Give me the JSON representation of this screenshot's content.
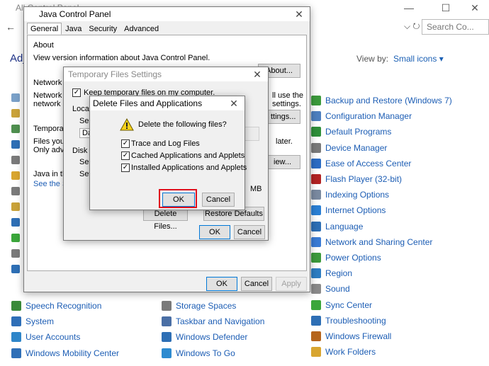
{
  "control_panel": {
    "title": "All Control Panel",
    "back_glyph": "←",
    "refresh_glyph": "⌵ ↻",
    "search_placeholder": "Search Co...",
    "heading": "Adj",
    "view_by_label": "View by:",
    "view_by_value": "Small icons ▾",
    "window_min": "—",
    "window_max": "☐",
    "window_close": "✕",
    "left_column": [
      {
        "label": "Speech Recognition",
        "icon": "speech-icon",
        "color": "#3a8a3a"
      },
      {
        "label": "System",
        "icon": "system-icon",
        "color": "#2f6fb7"
      },
      {
        "label": "User Accounts",
        "icon": "users-icon",
        "color": "#2f86c9"
      },
      {
        "label": "Windows Mobility Center",
        "icon": "mobility-icon",
        "color": "#2f6fb7"
      }
    ],
    "middle_column": [
      {
        "label": "Storage Spaces",
        "icon": "storage-icon",
        "color": "#7a7a7a"
      },
      {
        "label": "Taskbar and Navigation",
        "icon": "taskbar-icon",
        "color": "#4a6fa5"
      },
      {
        "label": "Windows Defender",
        "icon": "defender-icon",
        "color": "#2e6fb5"
      },
      {
        "label": "Windows To Go",
        "icon": "windows-to-go-icon",
        "color": "#2e8bd0"
      }
    ],
    "right_column": [
      {
        "label": "Backup and Restore (Windows 7)",
        "icon": "backup-icon",
        "color": "#3c9a3c"
      },
      {
        "label": "Configuration Manager",
        "icon": "config-icon",
        "color": "#4d7fbf"
      },
      {
        "label": "Default Programs",
        "icon": "default-programs-icon",
        "color": "#2f8f3a"
      },
      {
        "label": "Device Manager",
        "icon": "device-manager-icon",
        "color": "#7a7a7a"
      },
      {
        "label": "Ease of Access Center",
        "icon": "ease-of-access-icon",
        "color": "#2b6cc4"
      },
      {
        "label": "Flash Player (32-bit)",
        "icon": "flash-icon",
        "color": "#b22222"
      },
      {
        "label": "Indexing Options",
        "icon": "indexing-icon",
        "color": "#7a8aa0"
      },
      {
        "label": "Internet Options",
        "icon": "internet-icon",
        "color": "#2a7fd4"
      },
      {
        "label": "Language",
        "icon": "language-icon",
        "color": "#2e6fb5"
      },
      {
        "label": "Network and Sharing Center",
        "icon": "network-icon",
        "color": "#3a7bd5"
      },
      {
        "label": "Power Options",
        "icon": "power-icon",
        "color": "#3c9a3c"
      },
      {
        "label": "Region",
        "icon": "region-icon",
        "color": "#2e7dc2"
      },
      {
        "label": "Sound",
        "icon": "sound-icon",
        "color": "#8a8a8a"
      },
      {
        "label": "Sync Center",
        "icon": "sync-icon",
        "color": "#3aa63a"
      },
      {
        "label": "Troubleshooting",
        "icon": "troubleshooting-icon",
        "color": "#2e6fb5"
      },
      {
        "label": "Windows Firewall",
        "icon": "firewall-icon",
        "color": "#b5651d"
      },
      {
        "label": "Work Folders",
        "icon": "work-folders-icon",
        "color": "#d8a530"
      }
    ]
  },
  "java_control_panel": {
    "title": "Java Control Panel",
    "close_glyph": "✕",
    "tabs": [
      "General",
      "Java",
      "Security",
      "Advanced"
    ],
    "about_heading": "About",
    "about_text": "View version information about Java Control Panel.",
    "about_button": "About...",
    "network_heading": "Network S",
    "network_text_1": "Network s",
    "network_text_2": "network se",
    "network_text_right_1": "ll use the",
    "network_text_right_2": "settings.",
    "network_button": "ttings...",
    "temp_heading": "Temporary",
    "temp_text_1": "Files you u",
    "temp_text_2": "Only adva",
    "temp_text_right": "later.",
    "temp_button": "iew...",
    "java_in_text": "Java in the",
    "see_link": "See the Se",
    "ok": "OK",
    "cancel": "Cancel",
    "apply": "Apply"
  },
  "temp_files_settings": {
    "title": "Temporary Files Settings",
    "close_glyph": "✕",
    "keep_files_label": "Keep temporary files on my computer.",
    "keep_files_checked": "✓",
    "location_label": "Locatio",
    "select_label": "Sel",
    "location_value": "Da",
    "disk_space_label": "Disk S",
    "select_label_2": "Sel",
    "set_label": "Set",
    "unit": "MB",
    "delete_files_button": "Delete Files...",
    "restore_defaults_button": "Restore Defaults",
    "ok": "OK",
    "cancel": "Cancel"
  },
  "delete_files_dialog": {
    "title": "Delete Files and Applications",
    "close_glyph": "✕",
    "prompt": "Delete the following files?",
    "options": [
      {
        "label": "Trace and Log Files",
        "checked": "✓"
      },
      {
        "label": "Cached Applications and Applets",
        "checked": "✓"
      },
      {
        "label": "Installed Applications and Applets",
        "checked": "✓"
      }
    ],
    "ok": "OK",
    "cancel": "Cancel",
    "highlight_color": "#e0101d"
  }
}
